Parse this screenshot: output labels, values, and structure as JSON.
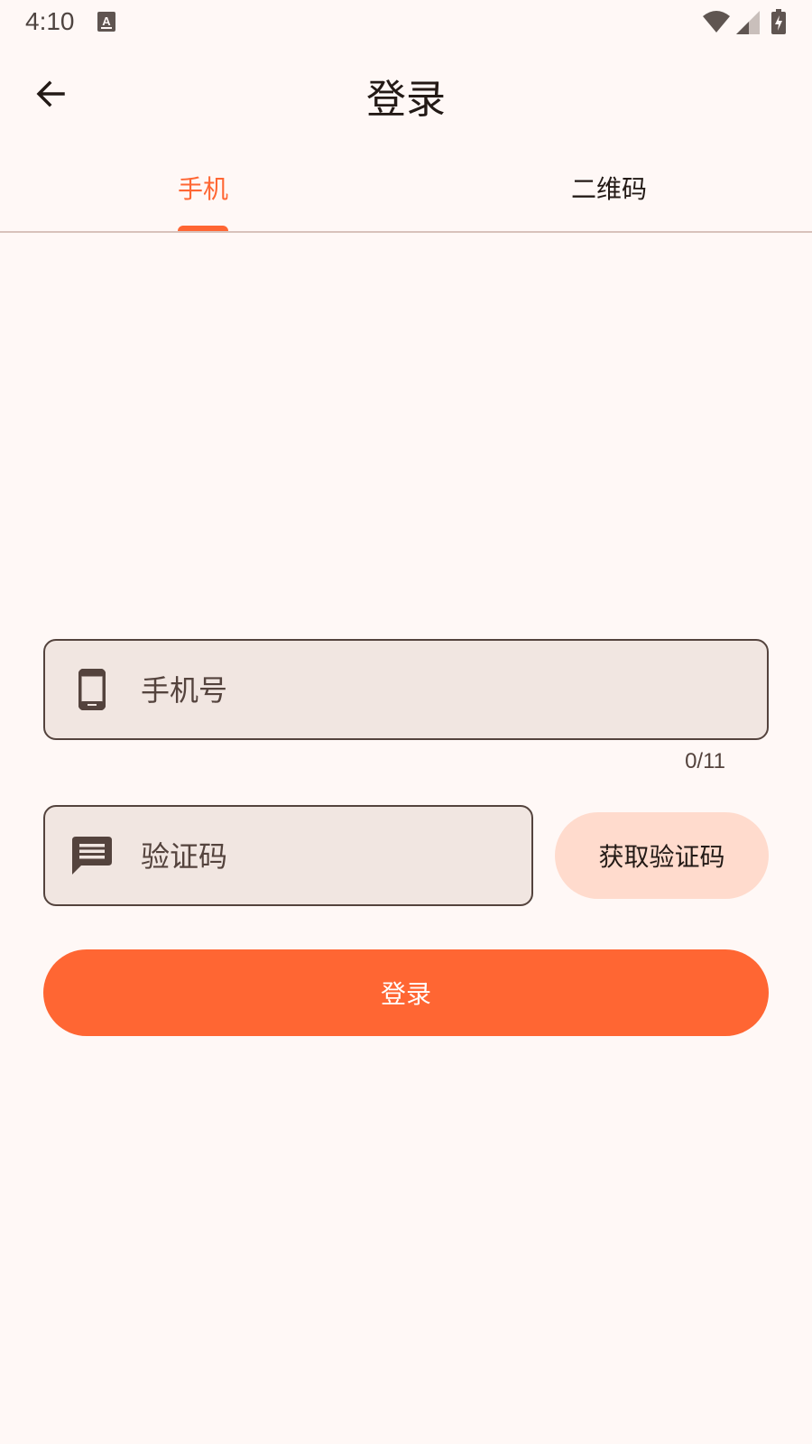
{
  "status_bar": {
    "time": "4:10"
  },
  "app_bar": {
    "title": "登录"
  },
  "tabs": [
    {
      "label": "手机",
      "selected": true
    },
    {
      "label": "二维码",
      "selected": false
    }
  ],
  "form": {
    "phone": {
      "placeholder": "手机号",
      "value": "",
      "counter": "0/11"
    },
    "code": {
      "placeholder": "验证码",
      "value": ""
    },
    "get_code_label": "获取验证码",
    "login_label": "登录"
  },
  "icons": {
    "back": "arrow-back-icon",
    "phone": "smartphone-icon",
    "code": "message-icon"
  },
  "colors": {
    "accent": "#ff6633",
    "background": "#fff8f6",
    "field_fill": "#f1e6e1",
    "secondary_button": "#ffdbcd"
  }
}
